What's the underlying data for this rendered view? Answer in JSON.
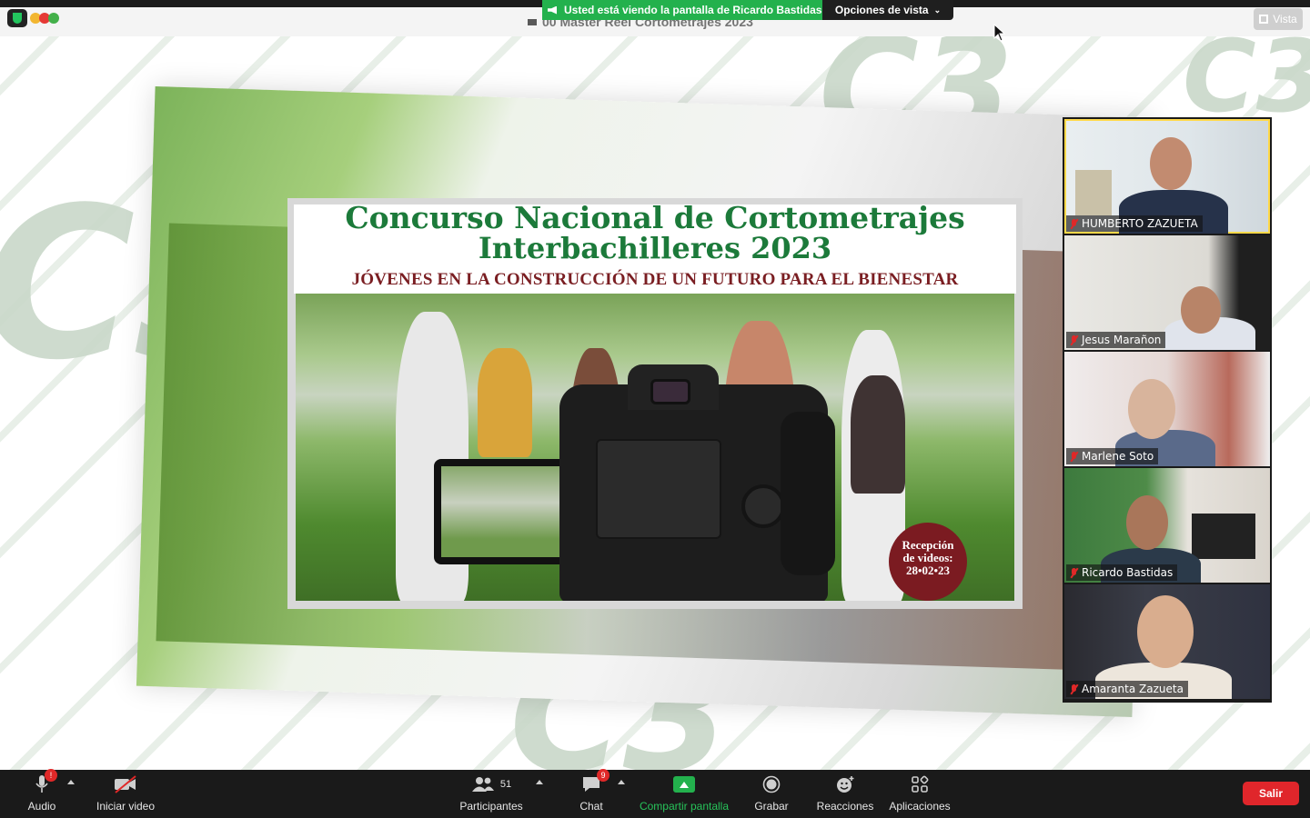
{
  "topbar": {
    "share_banner": "Usted está viendo la pantalla de Ricardo Bastidas",
    "view_options": "Opciones de vista",
    "shared_title": "00 Master Reel Cortometrajes 2023",
    "vista": "Vista"
  },
  "flyer": {
    "title_line1": "Concurso Nacional de Cortometrajes",
    "title_line2": "Interbachilleres 2023",
    "subtitle": "JÓVENES EN LA CONSTRUCCIÓN DE UN FUTURO PARA EL BIENESTAR",
    "seal_line1": "Recepción",
    "seal_line2": "de videos:",
    "seal_line3": "28•02•23"
  },
  "participants": [
    {
      "name": "HUMBERTO ZAZUETA",
      "muted": true
    },
    {
      "name": "Jesus Marañon",
      "muted": true
    },
    {
      "name": "Marlene Soto",
      "muted": true
    },
    {
      "name": "Ricardo Bastidas",
      "muted": true
    },
    {
      "name": "Amaranta Zazueta",
      "muted": true
    }
  ],
  "toolbar": {
    "audio": "Audio",
    "audio_badge": "!",
    "video": "Iniciar video",
    "participants": "Participantes",
    "participants_count": "51",
    "chat": "Chat",
    "chat_badge": "9",
    "share": "Compartir pantalla",
    "record": "Grabar",
    "reactions": "Reacciones",
    "apps": "Aplicaciones",
    "leave": "Salir"
  },
  "colors": {
    "share_green": "#23b14d",
    "leave_red": "#e0262b",
    "active_speaker": "#ffd94a"
  }
}
